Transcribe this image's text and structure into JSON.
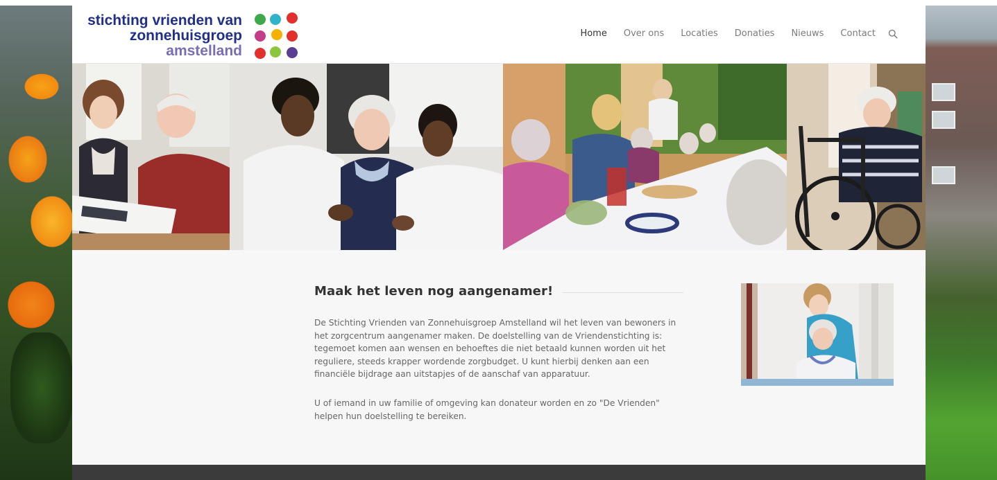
{
  "logo": {
    "line1": "stichting vrienden van",
    "line2": "zonnehuisgroep",
    "line3": "amstelland",
    "dot_colors": [
      "#3fa84a",
      "#2eb3c8",
      "#e2312d",
      "#c43c8a",
      "#f5b100",
      "#e2312d",
      "#e2312d",
      "#8cc63f",
      "#5a3e91"
    ]
  },
  "nav": {
    "items": [
      "Home",
      "Over ons",
      "Locaties",
      "Donaties",
      "Nieuws",
      "Contact"
    ],
    "active": "Home",
    "search_icon": "search-icon"
  },
  "hero": {
    "photos": [
      "elderly-man-with-caregiver-reading",
      "nurses-with-elderly-woman",
      "residents-dining-outdoors",
      "elderly-woman-in-wheelchair"
    ]
  },
  "main": {
    "heading": "Maak het leven nog aangenamer!",
    "paragraph1": "De Stichting Vrienden van Zonnehuisgroep Amstelland wil het leven van bewoners in het zorgcentrum aangenamer maken. De doelstelling van de Vriendenstichting is: tegemoet komen aan wensen en behoeftes die niet betaald kunnen worden uit het reguliere, steeds krapper wordende zorgbudget. U kunt hierbij denken aan een financiële bijdrage aan uitstapjes of de aanschaf van apparatuur.",
    "paragraph2": "U of iemand in uw familie of omgeving kan donateur worden en zo \"De Vrienden\" helpen hun doelstelling te bereiken.",
    "side_photo": "caregiver-with-elderly-woman"
  },
  "colors": {
    "logo_blue": "#1f2f8a",
    "logo_purple": "#7a6db4",
    "nav_text": "#7b7b7b",
    "nav_active": "#333333",
    "content_bg": "#f7f7f7",
    "footer_bg": "#3b3b3b"
  }
}
